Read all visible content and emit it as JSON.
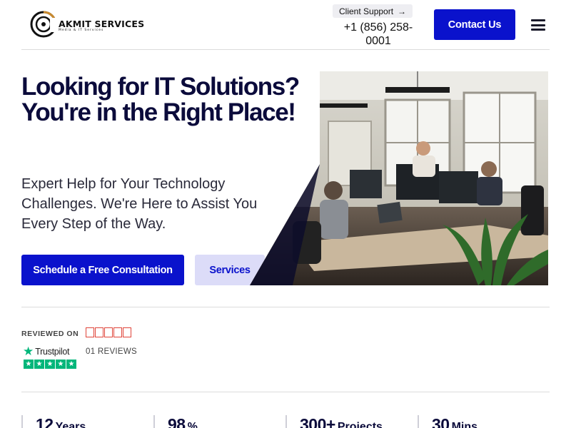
{
  "header": {
    "logo_title": "AKMIT SERVICES",
    "logo_subtitle": "Media & IT Services",
    "client_support_label": "Client Support",
    "client_support_arrow": "→",
    "phone": "+1 (856) 258-0001",
    "contact_label": "Contact Us"
  },
  "hero": {
    "title": "Looking for IT Solutions? You're in the Right Place!",
    "subtitle": "Expert Help for Your Technology Challenges. We're Here to Assist You Every Step of the Way.",
    "primary_button": "Schedule a Free Consultation",
    "secondary_button": "Services"
  },
  "reviews": {
    "reviewed_on": "REVIEWED ON",
    "platform": "Trustpilot",
    "count": "01 REVIEWS",
    "rating_stars": 5
  },
  "stats": [
    {
      "number": "12",
      "unit": "Years"
    },
    {
      "number": "98",
      "unit": "%"
    },
    {
      "number": "300+",
      "unit": "Projects"
    },
    {
      "number": "30",
      "unit": "Mins"
    }
  ],
  "colors": {
    "brand_blue": "#0a12cc",
    "brand_blue_light": "#dcdcf8",
    "heading": "#0b0b3b",
    "trustpilot_green": "#00b67a"
  }
}
